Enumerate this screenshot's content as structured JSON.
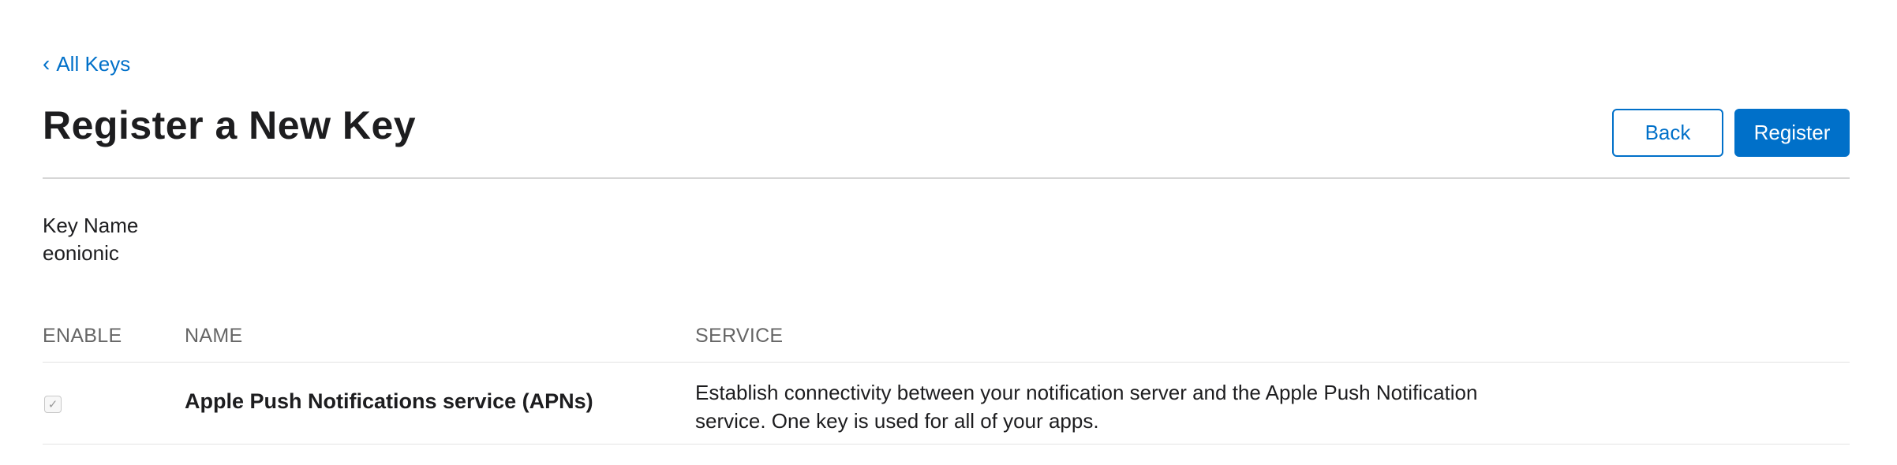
{
  "breadcrumb": {
    "chevron": "‹",
    "label": "All Keys"
  },
  "page": {
    "title": "Register a New Key"
  },
  "actions": {
    "back_label": "Back",
    "register_label": "Register"
  },
  "key": {
    "name_label": "Key Name",
    "name_value": "eonionic"
  },
  "table": {
    "headers": {
      "enable": "ENABLE",
      "name": "NAME",
      "service": "SERVICE"
    },
    "rows": [
      {
        "enabled": true,
        "check_glyph": "✓",
        "name": "Apple Push Notifications service (APNs)",
        "service": "Establish connectivity between your notification server and the Apple Push Notification service. One key is used for all of your apps."
      }
    ]
  },
  "colors": {
    "accent": "#0070c9",
    "text": "#1d1d1f",
    "muted": "#666666",
    "divider": "#d6d6d6"
  },
  "icons": {
    "breadcrumb": "chevron-left-icon",
    "checkbox": "checkmark-icon"
  }
}
